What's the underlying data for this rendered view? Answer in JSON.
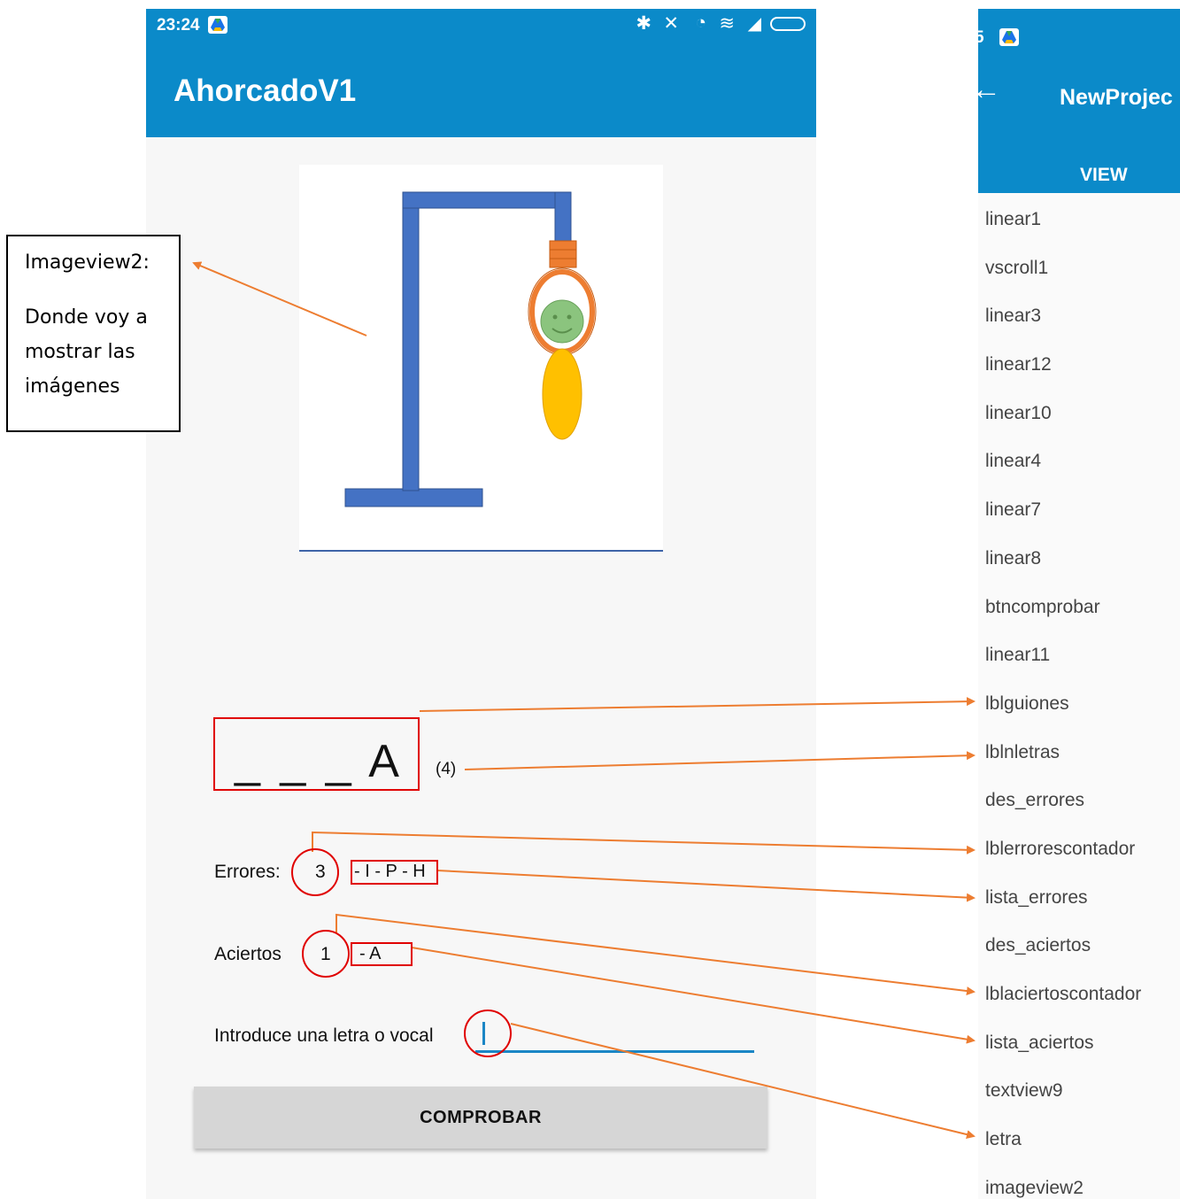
{
  "status_bar": {
    "time": "23:24"
  },
  "app_bar": {
    "title": "AhorcadoV1"
  },
  "game": {
    "guiones": "_ _ _ A",
    "num_letras": "(4)",
    "errores_label": "Errores:",
    "errores_count": "3",
    "errores_list": "- I - P - H",
    "aciertos_label": "Aciertos",
    "aciertos_count": "1",
    "aciertos_list": "- A",
    "prompt": "Introduce una letra o vocal",
    "input_value": "",
    "button_label": "COMPROBAR"
  },
  "callout": {
    "title": "Imageview2:",
    "description": "Donde voy a mostrar las imágenes"
  },
  "right_panel": {
    "status_time": "5",
    "back_icon": "arrow-back-icon",
    "title": "NewProjec",
    "tab": "VIEW",
    "items": [
      "linear1",
      "vscroll1",
      "linear3",
      "linear12",
      "linear10",
      "linear4",
      "linear7",
      "linear8",
      "btncomprobar",
      "linear11",
      "lblguiones",
      "lblnletras",
      "des_errores",
      "lblerrorescontador",
      "lista_errores",
      "des_aciertos",
      "lblaciertoscontador",
      "lista_aciertos",
      "textview9",
      "letra",
      "imageview2"
    ]
  },
  "colors": {
    "app_bar": "#0b8ac9",
    "annotation_arrow": "#ed7d31",
    "highlight": "#e00000",
    "gallows": "#4472c4",
    "rope": "#ed7d31",
    "face": "#8bc47e",
    "body": "#ffc000"
  }
}
